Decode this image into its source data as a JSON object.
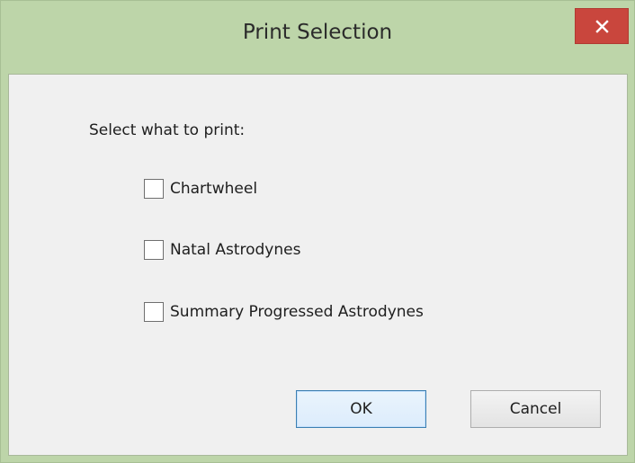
{
  "window": {
    "title": "Print Selection",
    "close_icon": "close-icon"
  },
  "dialog": {
    "prompt": "Select what to print:",
    "options": [
      {
        "label": "Chartwheel",
        "checked": false
      },
      {
        "label": "Natal Astrodynes",
        "checked": false
      },
      {
        "label": "Summary Progressed Astrodynes",
        "checked": false
      }
    ],
    "ok_label": "OK",
    "cancel_label": "Cancel"
  },
  "colors": {
    "frame": "#bdd5a9",
    "close_button": "#c9463d",
    "client_background": "#f0f0f0",
    "default_button_border": "#3c7fb1"
  }
}
